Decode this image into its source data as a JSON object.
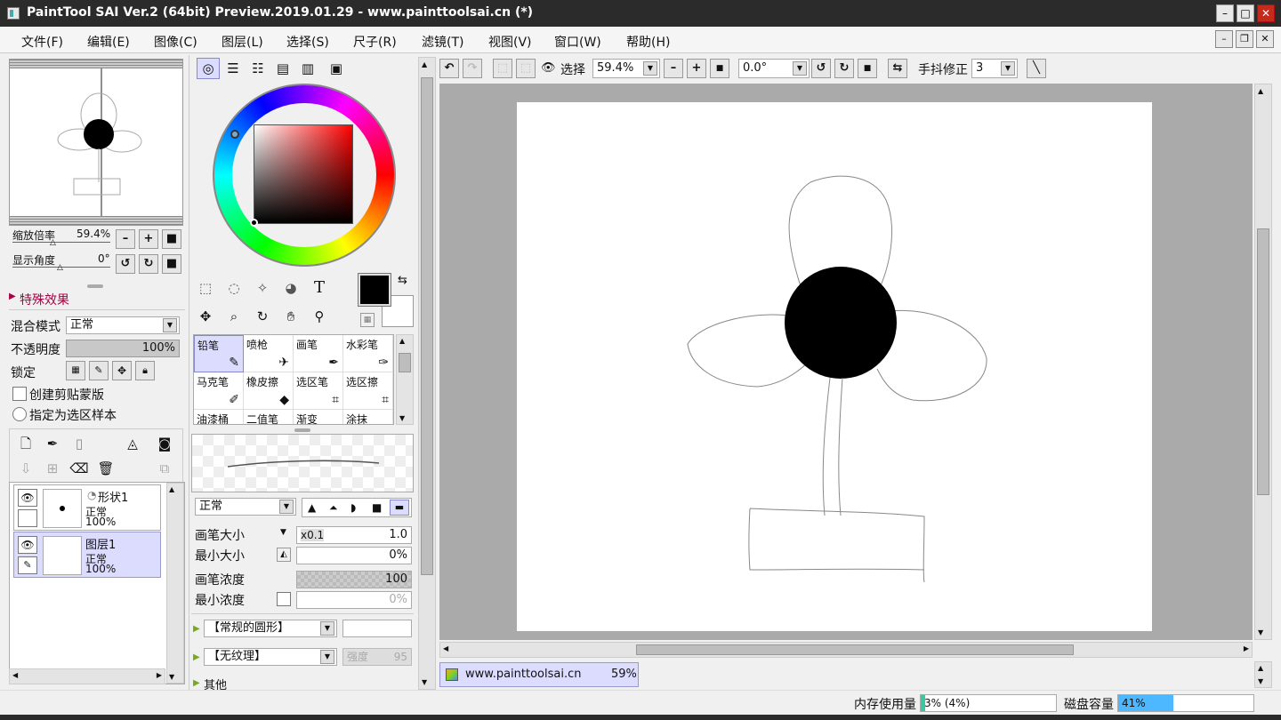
{
  "window": {
    "title": "PaintTool SAI Ver.2 (64bit) Preview.2019.01.29 - www.painttoolsai.cn (*)",
    "min": "–",
    "max": "□",
    "close": "✕"
  },
  "menu": [
    "文件(F)",
    "编辑(E)",
    "图像(C)",
    "图层(L)",
    "选择(S)",
    "尺子(R)",
    "滤镜(T)",
    "视图(V)",
    "窗口(W)",
    "帮助(H)"
  ],
  "navigator": {
    "zoom_label": "缩放倍率",
    "zoom_value": "59.4%",
    "angle_label": "显示角度",
    "angle_value": "0°"
  },
  "layer_props": {
    "effects_label": "特殊效果",
    "blend_label": "混合模式",
    "blend_value": "正常",
    "opacity_label": "不透明度",
    "opacity_value": "100%",
    "opacity": 1.0,
    "lock_label": "锁定",
    "clip_label": "创建剪贴蒙版",
    "sample_label": "指定为选区样本"
  },
  "layers": [
    {
      "name": "形状1",
      "mode": "正常",
      "opacity": "100%"
    },
    {
      "name": "图层1",
      "mode": "正常",
      "opacity": "100%"
    }
  ],
  "brushes": [
    [
      "铅笔",
      "喷枪",
      "画笔",
      "水彩笔"
    ],
    [
      "马克笔",
      "橡皮擦",
      "选区笔",
      "选区擦"
    ],
    [
      "油漆桶",
      "二值笔",
      "渐变",
      "涂抹"
    ]
  ],
  "brush_settings": {
    "mode_value": "正常",
    "size_label": "画笔大小",
    "size_mult": "x0.1",
    "size_value": "1.0",
    "min_size_label": "最小大小",
    "min_size_value": "0%",
    "density_label": "画笔浓度",
    "density_value": "100",
    "min_density_label": "最小浓度",
    "min_density_value": "0%",
    "shape_value": "【常规的圆形】",
    "texture_value": "【无纹理】",
    "strength_label": "强度",
    "strength_value": "95",
    "other_label": "其他"
  },
  "toolbar": {
    "select_label": "选择",
    "zoom_value": "59.4%",
    "angle_value": "0.0°",
    "stabilizer_label": "手抖修正",
    "stabilizer_value": "3"
  },
  "document_tab": {
    "name": "www.painttoolsai.cn",
    "zoom": "59%"
  },
  "status": {
    "memory_label": "内存使用量",
    "memory_value": "3% (4%)",
    "memory_fraction": 0.03,
    "disk_label": "磁盘容量",
    "disk_value": "41%",
    "disk_fraction": 0.41
  },
  "colors": {
    "accent": "#dcdcff",
    "disk_bar": "#4db8ff",
    "memory_bar": "#38c9a0",
    "fg": "#000000",
    "bg": "#ffffff"
  }
}
